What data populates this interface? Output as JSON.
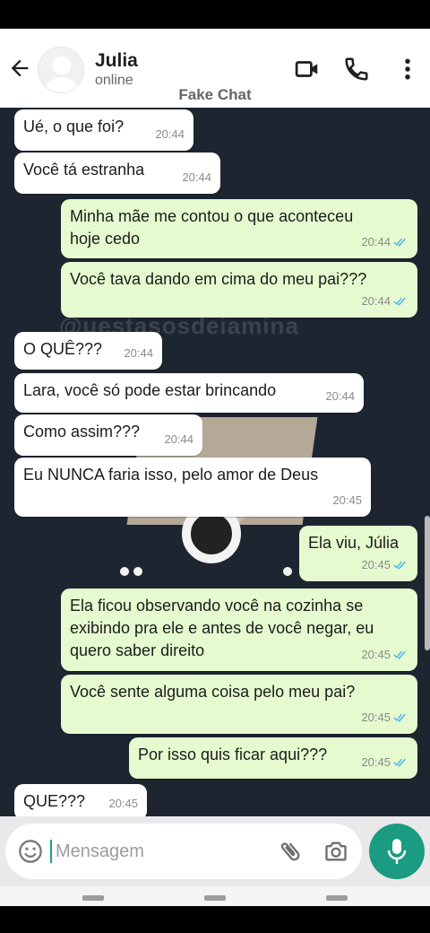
{
  "header": {
    "contact_name": "Julia",
    "status": "online",
    "label": "Fake Chat",
    "icons": [
      "back-arrow-icon",
      "avatar",
      "video-call-icon",
      "phone-call-icon",
      "more-options-icon"
    ]
  },
  "watermark": {
    "text": "@uestasosdeiamina"
  },
  "messages": [
    {
      "dir": "in",
      "text": "Ué, o que foi?",
      "time": "20:44"
    },
    {
      "dir": "in",
      "text": "Você tá estranha",
      "time": "20:44"
    },
    {
      "dir": "out",
      "text": "Minha mãe me contou o que aconteceu\nhoje cedo",
      "time": "20:44",
      "read": true
    },
    {
      "dir": "out",
      "text": "Você tava dando em cima do meu pai???",
      "time": "20:44",
      "read": true
    },
    {
      "dir": "in",
      "text": "O QUÊ???",
      "time": "20:44"
    },
    {
      "dir": "in",
      "text": "Lara, você só pode estar brincando",
      "time": "20:44"
    },
    {
      "dir": "in",
      "text": "Como assim???",
      "time": "20:44"
    },
    {
      "dir": "in",
      "text": "Eu NUNCA faria isso, pelo amor de Deus",
      "time": "20:45"
    },
    {
      "dir": "out",
      "text": "Ela viu, Júlia",
      "time": "20:45",
      "read": true
    },
    {
      "dir": "out",
      "text": "Ela ficou observando você na cozinha se\nexibindo pra ele e antes de você negar, eu\nquero saber direito",
      "time": "20:45",
      "read": true
    },
    {
      "dir": "out",
      "text": "Você sente alguma coisa pelo meu pai?",
      "time": "20:45",
      "read": true
    },
    {
      "dir": "out",
      "text": "Por isso quis ficar aqui???",
      "time": "20:45",
      "read": true
    },
    {
      "dir": "in",
      "text": "QUE???",
      "time": "20:45"
    }
  ],
  "composer": {
    "placeholder": "Mensagem",
    "icons": [
      "emoji-icon",
      "attach-icon",
      "camera-icon",
      "microphone-icon"
    ]
  },
  "colors": {
    "incoming_bubble": "#ffffff",
    "outgoing_bubble": "#e5fbcf",
    "read_ticks": "#4fb6ec",
    "mic_button": "#1a9b82",
    "chat_background": "#1d2530"
  }
}
